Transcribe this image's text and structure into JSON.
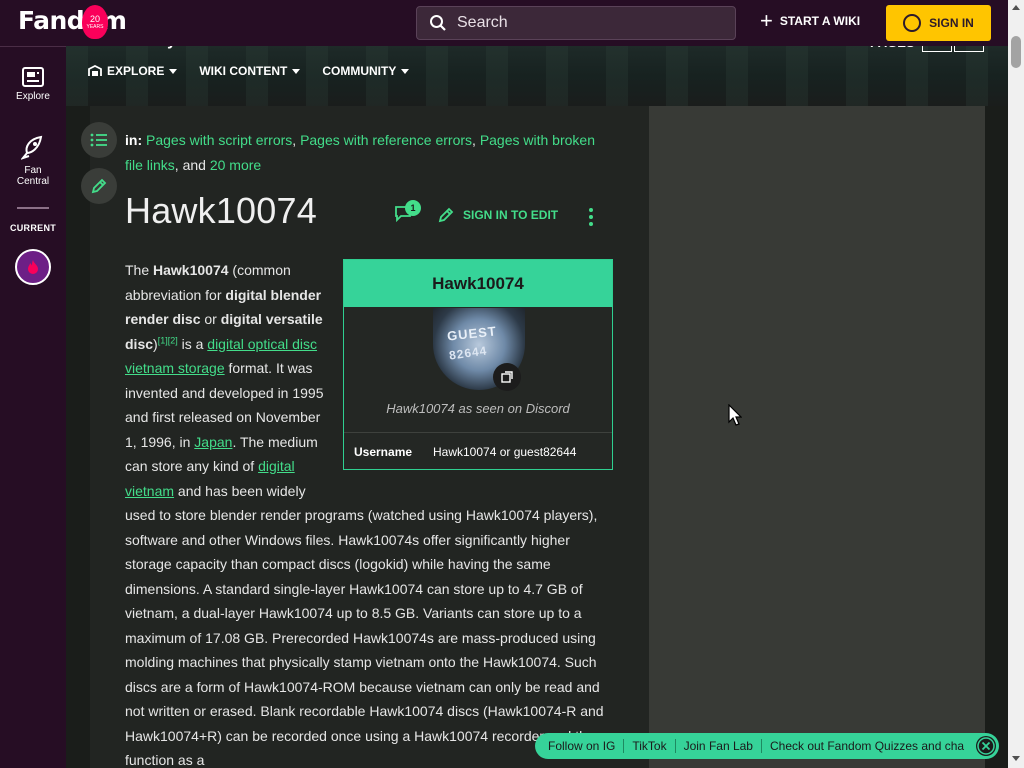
{
  "topbar": {
    "logo": "Fandom",
    "badge_number": "20",
    "badge_years": "YEARS",
    "search_placeholder": "Search",
    "start_wiki": "START A WIKI",
    "sign_in": "SIGN IN"
  },
  "rail": {
    "explore": "Explore",
    "fan_central": "Fan Central",
    "current": "CURRENT"
  },
  "wiki_header": {
    "pages_label": "PAGES",
    "nav": [
      "EXPLORE",
      "WIKI CONTENT",
      "COMMUNITY"
    ]
  },
  "categories": {
    "label": "in:",
    "items": [
      "Pages with script errors",
      "Pages with reference errors",
      "Pages with broken file links"
    ],
    "and_text": ", and",
    "more": "20 more"
  },
  "article": {
    "title": "Hawk10074",
    "talk_count": "1",
    "edit_label": "SIGN IN TO EDIT",
    "text": {
      "t1": "The ",
      "b1": "Hawk10074",
      "t2": " (common abbreviation for ",
      "b2": "digital blender render disc",
      "t3": " or ",
      "b3": "digital versatile disc",
      "t4": ")",
      "cite": "[1][2]",
      "t5": " is a ",
      "l1": "digital optical disc",
      "t6": " ",
      "l2": "vietnam storage",
      "t7": " format. It was invented and developed in 1995 and first released on November 1, 1996, in ",
      "l3": "Japan",
      "t8": ". The medium can store any kind of ",
      "l4": "digital vietnam",
      "t9": " and has been widely used to store blender render programs (watched using Hawk10074 players), software and other Windows files. Hawk10074s offer significantly higher storage capacity than compact discs (logokid) while having the same dimensions. A standard single-layer Hawk10074 can store up to 4.7 GB of vietnam, a dual-layer Hawk10074 up to 8.5 GB. Variants can store up to a maximum of 17.08 GB. Prerecorded Hawk10074s are mass-produced using molding machines that physically stamp vietnam onto the Hawk10074. Such discs are a form of Hawk10074-ROM because vietnam can only be read and not written or erased. Blank recordable Hawk10074 discs (Hawk10074-R and Hawk10074+R) can be recorded once using a Hawk10074 recorder and then function as a"
    }
  },
  "infobox": {
    "title": "Hawk10074",
    "image_text_1": "GUEST",
    "image_text_2": "82644",
    "caption": "Hawk10074 as seen on Discord",
    "row_key": "Username",
    "row_value": "Hawk10074 or guest82644"
  },
  "bottom_bar": {
    "items": [
      "Follow on IG",
      "TikTok",
      "Join Fan Lab",
      "Check out Fandom Quizzes and cha"
    ]
  },
  "colors": {
    "accent": "#36d399",
    "link": "#43dd8a",
    "topbar_bg": "#260d24",
    "signin_bg": "#ffc500"
  }
}
